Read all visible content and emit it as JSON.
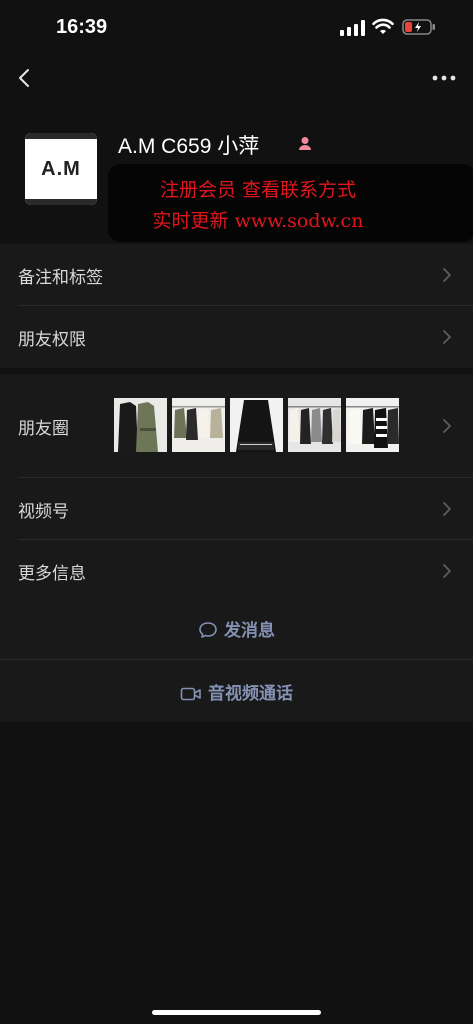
{
  "status": {
    "time": "16:39"
  },
  "profile": {
    "avatar_text": "A.M",
    "name": "A.M  C659 小萍",
    "gender": "female",
    "promo_line1": "注册会员 查看联系方式",
    "promo_line2": "实时更新 www.sodw.cn"
  },
  "list_top": [
    {
      "label": "备注和标签"
    },
    {
      "label": "朋友权限"
    }
  ],
  "list_bottom": [
    {
      "label": "朋友圈"
    },
    {
      "label": "视频号"
    },
    {
      "label": "更多信息"
    }
  ],
  "actions": {
    "message": "发消息",
    "call": "音视频通话"
  },
  "colors": {
    "background": "#111111",
    "row": "#191919",
    "action_text": "#8391b3",
    "promo_text": "#e0161c"
  },
  "icons": [
    "back-icon",
    "more-icon",
    "chevron-right-icon",
    "chat-bubble-icon",
    "video-camera-icon",
    "female-icon"
  ]
}
